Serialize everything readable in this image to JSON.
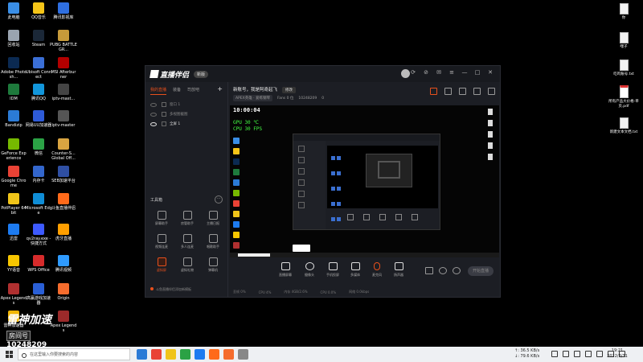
{
  "desktop": {
    "left_icons": [
      {
        "label": "此电脑",
        "color": "#3a8ee6"
      },
      {
        "label": "QQ音乐",
        "color": "#f5c518"
      },
      {
        "label": "腾讯影视库",
        "color": "#2f6fe0"
      },
      {
        "label": "回收站",
        "color": "#9aa4b0"
      },
      {
        "label": "Steam",
        "color": "#1b2838"
      },
      {
        "label": "PUBG BATTLEGR...",
        "color": "#c79a3a"
      },
      {
        "label": "Adobe Photosh...",
        "color": "#0b2a52"
      },
      {
        "label": "Ubisoft Connect",
        "color": "#3b6fd6"
      },
      {
        "label": "MSI Afterburner",
        "color": "#b30000"
      },
      {
        "label": "IDM",
        "color": "#1e7a3c"
      },
      {
        "label": "腾讯QQ",
        "color": "#1296db"
      },
      {
        "label": "iptv-mast...",
        "color": "#444444"
      },
      {
        "label": "Bandizip",
        "color": "#2b7bd6"
      },
      {
        "label": "网易UU加速器",
        "color": "#2e5bd8"
      },
      {
        "label": "iptv-master",
        "color": "#555555"
      },
      {
        "label": "GeForce Experience",
        "color": "#76b900"
      },
      {
        "label": "微信",
        "color": "#2ba245"
      },
      {
        "label": "Counter-S... Global Off...",
        "color": "#d9a441"
      },
      {
        "label": "Google Chrome",
        "color": "#e94235"
      },
      {
        "label": "内存卡",
        "color": "#3366cc"
      },
      {
        "label": "SEB加速平台",
        "color": "#2f4fa3"
      },
      {
        "label": "PotPlayer 64 bit",
        "color": "#f0c419"
      },
      {
        "label": "Microsoft Edge",
        "color": "#0f8dd6"
      },
      {
        "label": "斗鱼直播伴侣",
        "color": "#ff6a1a"
      },
      {
        "label": "迅雷",
        "color": "#1d7bf0"
      },
      {
        "label": "qv2ray.exe - 快捷方式",
        "color": "#3d5afe"
      },
      {
        "label": "虎牙直播",
        "color": "#ff9f00"
      },
      {
        "label": "YY语音",
        "color": "#f7c600"
      },
      {
        "label": "WPS Office",
        "color": "#d62b2b"
      },
      {
        "label": "腾讯视频",
        "color": "#2f9bff"
      },
      {
        "label": "Apex Legends",
        "color": "#b03030"
      },
      {
        "label": "高赢游戏加速器",
        "color": "#2a5fd6"
      },
      {
        "label": "Origin",
        "color": "#f56c2d"
      },
      {
        "label": "雷神加速器",
        "color": "#f2b705"
      },
      {
        "label": "",
        "color": "#000000"
      },
      {
        "label": "Apex Legends",
        "color": "#9c2a2a"
      }
    ],
    "right_icons": [
      {
        "label": "你",
        "type": "doc"
      },
      {
        "label": "嘿子",
        "type": "doc"
      },
      {
        "label": "吃鸡账号.txt",
        "type": "doc"
      },
      {
        "label": "所有产品大价格-单页.pdf",
        "type": "pdf"
      },
      {
        "label": "新建文本文档.txt",
        "type": "doc"
      }
    ]
  },
  "app": {
    "logo": "直播伴侣",
    "version_badge": "新版",
    "window_controls": [
      "⟳",
      "⊘",
      "✉",
      "≡",
      "—",
      "□",
      "✕"
    ],
    "sidebar_tabs": [
      {
        "label": "我的直播",
        "active": true
      },
      {
        "label": "装备",
        "active": false
      },
      {
        "label": "司放吧",
        "active": false
      }
    ],
    "add_label": "+",
    "scenes": [
      {
        "label": "窗口 1",
        "on": false
      },
      {
        "label": "多视图截图",
        "on": false
      },
      {
        "label": "全屏 1",
        "on": true
      }
    ],
    "toolbox_title": "工具箱",
    "toolbox_more": "···",
    "tools": [
      {
        "label": "屏幕助手",
        "accent": false
      },
      {
        "label": "房管助手",
        "accent": false
      },
      {
        "label": "主播日报",
        "accent": false
      },
      {
        "label": "视频连麦",
        "accent": false
      },
      {
        "label": "多人连麦",
        "accent": false
      },
      {
        "label": "唱歌助手",
        "accent": false
      },
      {
        "label": "虚拟屏",
        "accent": true
      },
      {
        "label": "虚拟礼物",
        "accent": false
      },
      {
        "label": "弹幕机",
        "accent": false
      }
    ],
    "footer_notice": "斗鱼直播伴侣添加新模板",
    "room_title": "新账号，我是阿奇起飞",
    "edit_label": "修改",
    "category": "APEX英雄 · 爱练钢琴",
    "fans_label": "Fans 0 位",
    "room_id": "10248209",
    "hot": "0",
    "preview": {
      "clock": "10:00:04",
      "fps_line1": "GPU 30 ℃",
      "fps_line2": "CPU 30 FPS"
    },
    "controls": [
      {
        "label": "直播屏幕"
      },
      {
        "label": "摄像头"
      },
      {
        "label": "手机投屏"
      },
      {
        "label": "多媒体"
      },
      {
        "label": "麦克风"
      },
      {
        "label": "扬声器"
      }
    ],
    "live_button": "开始直播",
    "status_items": [
      "丢帧 0%",
      "CPU 4%",
      "内存 4GB/2.6%",
      "CPU 0.0%",
      "网络 0.0kbps"
    ]
  },
  "overlay": {
    "title": "雷神加速",
    "tag": "房间号",
    "room_number": "10248209"
  },
  "taskbar": {
    "search_placeholder": "在这里输入你要搜索的内容",
    "apps": [
      "#2b7bd6",
      "#e94235",
      "#f0c419",
      "#2ba245",
      "#1d7bf0",
      "#ff6a1a",
      "#f56c2d",
      "#888888"
    ],
    "net_up": "↑: 36.5 KB/s",
    "net_down": "↓: 79.6 KB/s",
    "time": "19:21",
    "date": "2022/3/31"
  }
}
